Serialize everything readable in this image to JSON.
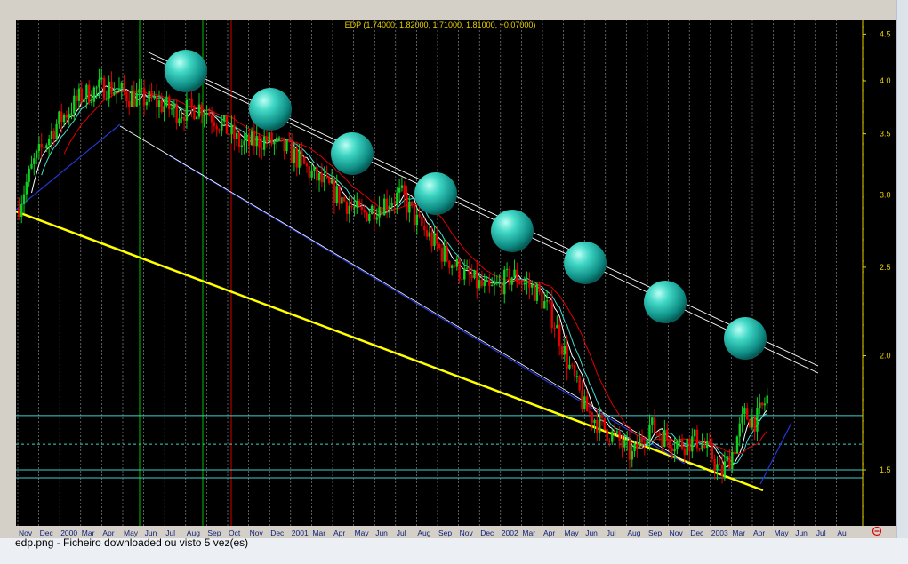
{
  "caption": "edp.png - Ficheiro downloaded ou visto 5 vez(es)",
  "chart_data": {
    "type": "candlestick",
    "title": "EDP (1.74000, 1.82000, 1.71000, 1.81000, +0.07000)",
    "y_scale": "log",
    "ylim": [
      1.3,
      4.6
    ],
    "y_ticks": [
      "4.5",
      "4.0",
      "3.5",
      "3.0",
      "2.5",
      "2.0",
      "1.5"
    ],
    "x_labels": [
      "Nov",
      "Dec",
      "2000",
      "Mar",
      "Apr",
      "May",
      "Jun",
      "Jul",
      "Aug",
      "Sep",
      "Oct",
      "Nov",
      "Dec",
      "2001",
      "Mar",
      "Apr",
      "May",
      "Jun",
      "Jul",
      "Aug",
      "Sep",
      "Nov",
      "Dec",
      "2002",
      "Mar",
      "Apr",
      "May",
      "Jun",
      "Jul",
      "Aug",
      "Sep",
      "Nov",
      "Dec",
      "2003",
      "Mar",
      "Apr",
      "May",
      "Jun",
      "Jul",
      "Au"
    ],
    "price_path": [
      [
        0,
        2.9
      ],
      [
        0.02,
        3.25
      ],
      [
        0.05,
        3.6
      ],
      [
        0.08,
        3.85
      ],
      [
        0.11,
        3.95
      ],
      [
        0.14,
        3.85
      ],
      [
        0.17,
        3.8
      ],
      [
        0.2,
        3.7
      ],
      [
        0.23,
        3.75
      ],
      [
        0.26,
        3.55
      ],
      [
        0.28,
        3.4
      ],
      [
        0.31,
        3.45
      ],
      [
        0.34,
        3.35
      ],
      [
        0.37,
        3.15
      ],
      [
        0.4,
        3.0
      ],
      [
        0.43,
        2.85
      ],
      [
        0.46,
        2.95
      ],
      [
        0.48,
        3.0
      ],
      [
        0.5,
        2.8
      ],
      [
        0.53,
        2.6
      ],
      [
        0.56,
        2.45
      ],
      [
        0.59,
        2.35
      ],
      [
        0.62,
        2.45
      ],
      [
        0.65,
        2.35
      ],
      [
        0.67,
        2.2
      ],
      [
        0.69,
        1.95
      ],
      [
        0.71,
        1.75
      ],
      [
        0.73,
        1.68
      ],
      [
        0.75,
        1.62
      ],
      [
        0.77,
        1.55
      ],
      [
        0.79,
        1.68
      ],
      [
        0.81,
        1.63
      ],
      [
        0.83,
        1.6
      ],
      [
        0.85,
        1.62
      ],
      [
        0.87,
        1.55
      ],
      [
        0.88,
        1.48
      ],
      [
        0.895,
        1.57
      ],
      [
        0.91,
        1.72
      ],
      [
        0.925,
        1.7
      ],
      [
        0.94,
        1.81
      ]
    ],
    "upper_channel": [
      [
        2000.0,
        4.4
      ],
      [
        2003.4,
        1.75
      ]
    ],
    "lower_support": [
      [
        1999.8,
        2.85
      ],
      [
        2003.1,
        1.35
      ]
    ],
    "horizontal_levels": [
      1.72,
      1.6,
      1.5,
      1.47
    ],
    "annotations": [
      "8 turquoise spheres marking successive lower highs along the descending resistance line"
    ]
  }
}
